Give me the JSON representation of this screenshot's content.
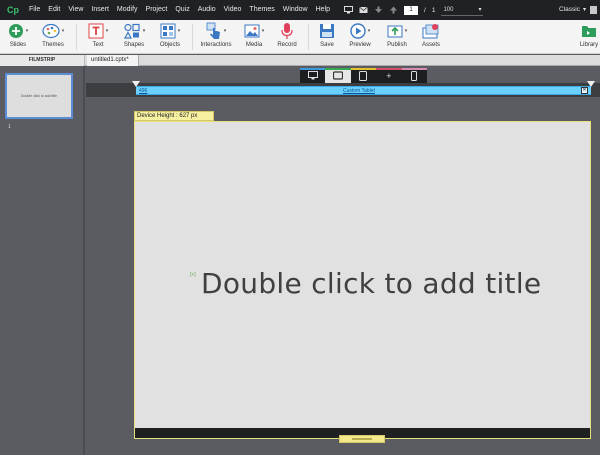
{
  "app": {
    "logo": "Cp"
  },
  "menu": [
    "File",
    "Edit",
    "View",
    "Insert",
    "Modify",
    "Project",
    "Quiz",
    "Audio",
    "Video",
    "Themes",
    "Window",
    "Help"
  ],
  "pager": {
    "current": "1",
    "separator": "/",
    "total": "1",
    "zoom": "100"
  },
  "workspace": "Classic",
  "toolbar": {
    "slides": "Slides",
    "themes": "Themes",
    "text": "Text",
    "shapes": "Shapes",
    "objects": "Objects",
    "interactions": "Interactions",
    "media": "Media",
    "record": "Record",
    "save": "Save",
    "preview": "Preview",
    "publish": "Publish",
    "assets": "Assets",
    "library": "Library"
  },
  "filmstrip": {
    "header": "FILMSTRIP",
    "thumb_text": "Double click to add title",
    "slide_number": "1"
  },
  "document_tab": "untitled1.cptx*",
  "stage": {
    "ruler_left": "496",
    "ruler_label": "Custom Tablet",
    "ruler_close": "✕",
    "device_height": "Device Height : 627 px",
    "title_placeholder": "Double click to add title",
    "handle_marker": "[+]"
  },
  "colors": {
    "accent_blue": "#6ad0ff",
    "device_frame": "#e8e07a",
    "strip_desktop": "#3a9bdc",
    "strip_tablet": "#34a853",
    "strip_mobile": "#e6c229",
    "strip_add": "#d24f6b",
    "strip_phone": "#d98ab0"
  }
}
